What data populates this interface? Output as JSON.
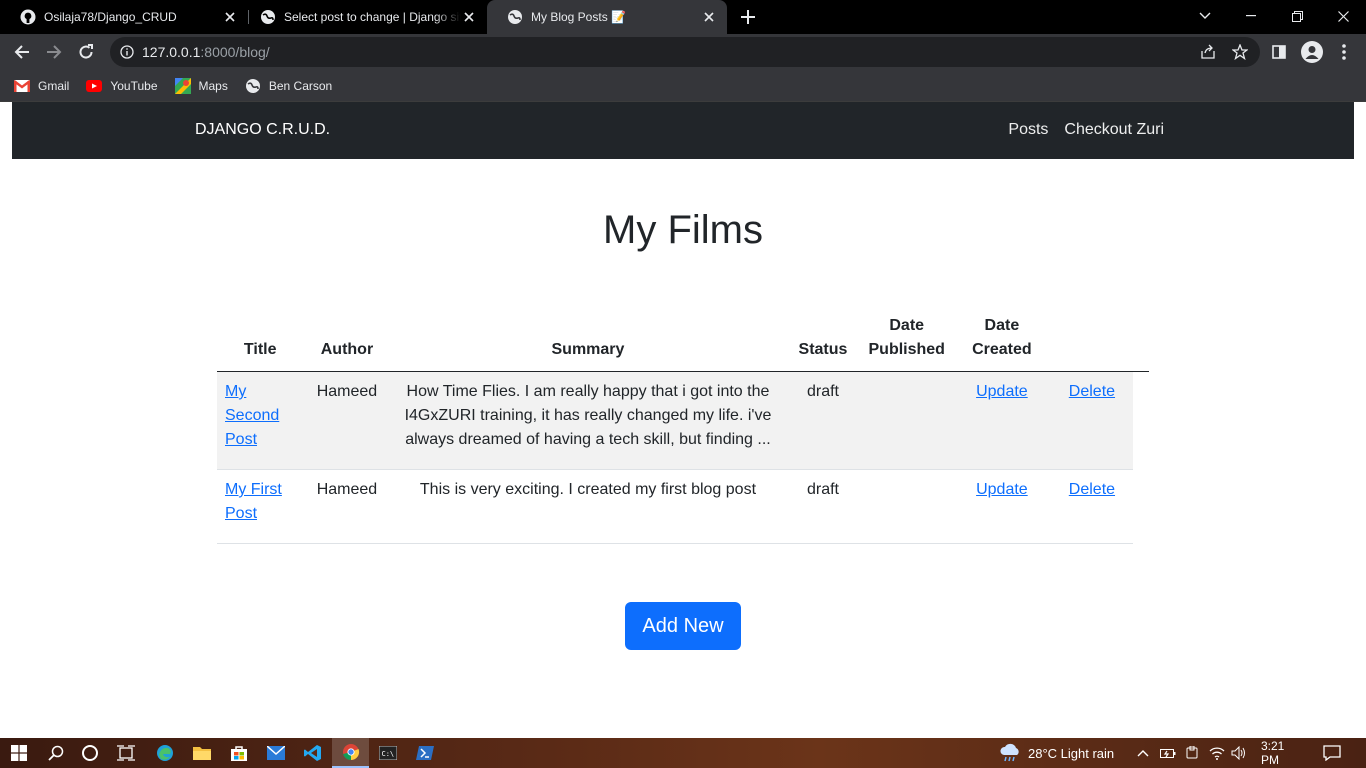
{
  "browser": {
    "tabs": [
      {
        "title": "Osilaja78/Django_CRUD",
        "icon": "github-icon",
        "active": false
      },
      {
        "title": "Select post to change | Django site admin",
        "icon": "globe-icon",
        "active": false
      },
      {
        "title": "My Blog Posts 📝",
        "icon": "globe-icon",
        "active": true
      }
    ],
    "url_host": "127.0.0.1",
    "url_path": ":8000/blog/",
    "bookmarks": [
      {
        "label": "Gmail",
        "icon": "gmail-icon"
      },
      {
        "label": "YouTube",
        "icon": "youtube-icon"
      },
      {
        "label": "Maps",
        "icon": "maps-icon"
      },
      {
        "label": "Ben Carson",
        "icon": "globe-icon"
      }
    ]
  },
  "site": {
    "brand": "DJANGO C.R.U.D.",
    "nav": [
      "Posts",
      "Checkout Zuri"
    ],
    "page_title": "My Films",
    "table": {
      "headers": [
        "Title",
        "Author",
        "Summary",
        "Status",
        "Date Published",
        "Date Created",
        "",
        ""
      ],
      "rows": [
        {
          "title": "My Second Post",
          "author": "Hameed",
          "summary": "How Time Flies. I am really happy that i got into the I4GxZURI training, it has really changed my life. i've always dreamed of having a tech skill, but finding ...",
          "status": "draft",
          "date_published": "",
          "date_created": "",
          "update": "Update",
          "delete": "Delete"
        },
        {
          "title": "My First Post",
          "author": "Hameed",
          "summary": "This is very exciting. I created my first blog post",
          "status": "draft",
          "date_published": "",
          "date_created": "",
          "update": "Update",
          "delete": "Delete"
        }
      ]
    },
    "add_button": "Add New",
    "colors": {
      "navbar": "#212529",
      "primary": "#0d6efd",
      "stripe": "#f2f2f2"
    }
  },
  "taskbar": {
    "weather": "28°C  Light rain",
    "time": "3:21 PM",
    "pinned": [
      "start-icon",
      "search-icon",
      "cortana-icon",
      "task-view-icon",
      "edge-icon",
      "file-explorer-icon",
      "store-icon",
      "mail-icon",
      "vscode-icon",
      "chrome-icon",
      "terminal-icon",
      "powershell-icon"
    ]
  }
}
